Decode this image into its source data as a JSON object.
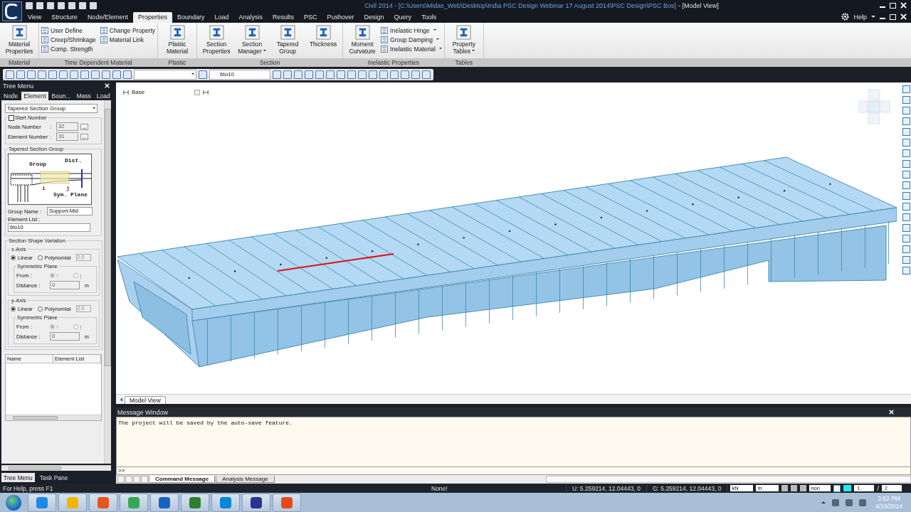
{
  "window": {
    "title": "Civil 2014 - [C:\\Users\\Midas_Web\\Desktop\\India PSC Design Webinar 17 August 2014\\PSC Design\\PSC Bos]",
    "document": "- [Model View]"
  },
  "menu_tabs": [
    {
      "label": "View",
      "selected": false
    },
    {
      "label": "Structure",
      "selected": false
    },
    {
      "label": "Node/Element",
      "selected": false
    },
    {
      "label": "Properties",
      "selected": true
    },
    {
      "label": "Boundary",
      "selected": false
    },
    {
      "label": "Load",
      "selected": false
    },
    {
      "label": "Analysis",
      "selected": false
    },
    {
      "label": "Results",
      "selected": false
    },
    {
      "label": "PSC",
      "selected": false
    },
    {
      "label": "Pushover",
      "selected": false
    },
    {
      "label": "Design",
      "selected": false
    },
    {
      "label": "Query",
      "selected": false
    },
    {
      "label": "Tools",
      "selected": false
    }
  ],
  "help": "Help",
  "ribbon": [
    {
      "label": "Material",
      "items": [
        {
          "kind": "large",
          "label": "Material Properties",
          "dropdown": false
        }
      ]
    },
    {
      "label": "Time Dependent Material",
      "items": [
        {
          "kind": "small",
          "label": "User Define",
          "dropdown": false
        },
        {
          "kind": "small",
          "label": "Creep/Shrinkage",
          "dropdown": false
        },
        {
          "kind": "small",
          "label": "Comp. Strength",
          "dropdown": false
        },
        {
          "kind": "small",
          "label": "Change Property",
          "dropdown": false
        },
        {
          "kind": "small",
          "label": "Material Link",
          "dropdown": false
        }
      ]
    },
    {
      "label": "Plastic",
      "items": [
        {
          "kind": "large",
          "label": "Plastic Material",
          "dropdown": false
        }
      ]
    },
    {
      "label": "Section",
      "items": [
        {
          "kind": "large",
          "label": "Section Properties",
          "dropdown": false
        },
        {
          "kind": "large",
          "label": "Section Manager",
          "dropdown": true
        },
        {
          "kind": "large",
          "label": "Tapered Group",
          "dropdown": false
        },
        {
          "kind": "large",
          "label": "Thickness",
          "dropdown": false
        }
      ]
    },
    {
      "label": "Inelastic Properties",
      "items": [
        {
          "kind": "large",
          "label": "Moment Curvature",
          "dropdown": false
        },
        {
          "kind": "small",
          "label": "Inelastic Hinge",
          "dropdown": true
        },
        {
          "kind": "small",
          "label": "Group Damping",
          "dropdown": true
        },
        {
          "kind": "small",
          "label": "Inelastic Material",
          "dropdown": true
        }
      ]
    },
    {
      "label": "Tables",
      "items": [
        {
          "kind": "large",
          "label": "Property Tables",
          "dropdown": true
        }
      ]
    }
  ],
  "toolbar": {
    "group_select": "6to10"
  },
  "tree_menu": {
    "title": "Tree Menu",
    "tabs": [
      {
        "label": "Node",
        "selected": false
      },
      {
        "label": "Element",
        "selected": true
      },
      {
        "label": "Boun...",
        "selected": false
      },
      {
        "label": "Mass",
        "selected": false
      },
      {
        "label": "Load",
        "selected": false
      }
    ],
    "function": "Tapered Section Group",
    "start_number": {
      "label": "Start Number",
      "checked": false,
      "fields": [
        {
          "label": "Node Number",
          "colon": ":",
          "value": "32"
        },
        {
          "label": "Element Number",
          "colon": ":",
          "value": "31"
        }
      ]
    },
    "group_box": {
      "title": "Tapered Section Group",
      "diagram_labels": [
        "Group",
        "Dist.",
        "i",
        "j",
        "Sym. Plane"
      ],
      "group_name_label": "Group Name :",
      "group_name": "Support-Mid",
      "element_list_label": "Element List :",
      "element_list": "6to10"
    },
    "variation": {
      "title": "Section Shape Variation",
      "axes": [
        {
          "title": "z-Axis",
          "options": [
            {
              "label": "Linear",
              "selected": true
            },
            {
              "label": "Polynomial",
              "selected": false
            }
          ],
          "order": "2.0",
          "plane_title": "Symmetric Plane",
          "from_label": "From :",
          "from_options": [
            {
              "label": "i",
              "selected": true
            },
            {
              "label": "j",
              "selected": false
            }
          ],
          "distance_label": "Distance :",
          "distance": "0",
          "unit": "m"
        },
        {
          "title": "y-Axis",
          "options": [
            {
              "label": "Linear",
              "selected": true
            },
            {
              "label": "Polynomial",
              "selected": false
            }
          ],
          "order": "2.0",
          "plane_title": "Symmetric Plane",
          "from_label": "From :",
          "from_options": [
            {
              "label": "i",
              "selected": true
            },
            {
              "label": "j",
              "selected": false
            }
          ],
          "distance_label": "Distance :",
          "distance": "0",
          "unit": "m"
        }
      ]
    },
    "list_columns": [
      "Name",
      "Element List"
    ],
    "bottom_tabs": [
      {
        "label": "Tree Menu",
        "selected": true
      },
      {
        "label": "Task Pane",
        "selected": false
      }
    ]
  },
  "model_view": {
    "story": "Base",
    "tab": "Model View"
  },
  "message_window": {
    "title": "Message Window",
    "text": "The project will be saved by the auto-save feature.",
    "prompt": ">>",
    "tabs": [
      {
        "label": "Command Message",
        "selected": true
      },
      {
        "label": "Analysis Message",
        "selected": false
      }
    ]
  },
  "status_bar": {
    "help": "For Help, press F1",
    "state": "None!",
    "u": "U: 5.259214, 12.04443, 0",
    "g": "G: 5.259214, 12.04443, 0",
    "force_unit": "kN",
    "length_unit": "m",
    "filter": "non",
    "page": "1",
    "page_sep": "/",
    "pages": "2"
  },
  "clock": {
    "time": "3:52 PM",
    "date": "4/18/2014"
  }
}
